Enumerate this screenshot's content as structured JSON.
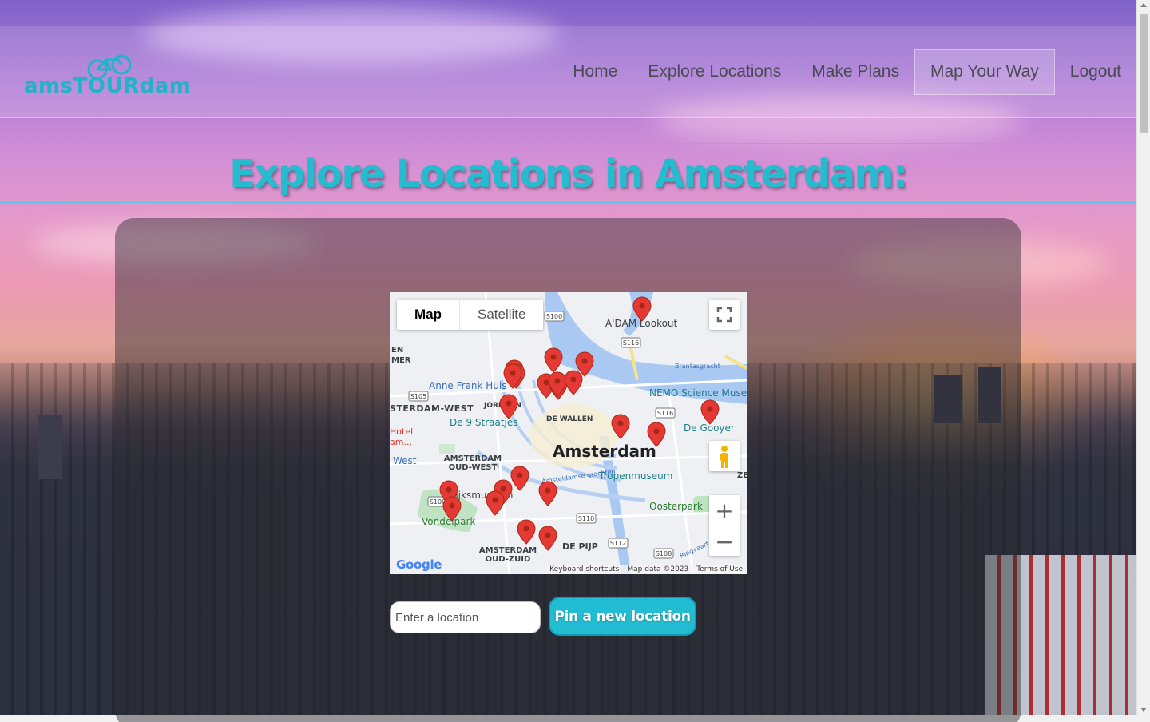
{
  "brand": {
    "logo_text": "amsTOURdam",
    "accent_color": "#1fb4c8"
  },
  "nav": {
    "items": [
      {
        "label": "Home"
      },
      {
        "label": "Explore Locations"
      },
      {
        "label": "Make Plans"
      },
      {
        "label": "Map Your Way",
        "active": true
      },
      {
        "label": "Logout"
      }
    ]
  },
  "page": {
    "title": "Explore Locations in Amsterdam:"
  },
  "map": {
    "type_controls": {
      "map": "Map",
      "satellite": "Satellite",
      "selected": "Map"
    },
    "center_label": "Amsterdam",
    "labels": {
      "adam": "A'DAM Lookout",
      "annefrank": "Anne Frank Huis",
      "nemo": "NEMO Science Muse",
      "westerdam": "STERDAM-WEST",
      "negenstraat": "De 9 Straatjes",
      "dewallen": "DE WALLEN",
      "hotel": "Hotel am...",
      "west": "West",
      "oudwest": "AMSTERDAM OUD-WEST",
      "rijks": "Rijksmuseum",
      "vondel": "Vondelpark",
      "tropen": "Tropenmuseum",
      "oosterpark": "Oosterpark",
      "depijp": "DE PIJP",
      "zuid": "AMSTERDAM OUD-ZUID",
      "dagaat": "De Gooyer",
      "jordaan": "JORDAAN",
      "en": "EN",
      "mer": "MER",
      "ze": "ZE",
      "brantas": "Brantasgracht",
      "amstel": "Amsteldamse grachten",
      "ringvaart": "Ringvaart"
    },
    "road_shields": [
      "S100",
      "S116",
      "S105",
      "S116",
      "S100",
      "S110",
      "S112",
      "S108"
    ],
    "attribution": {
      "shortcuts": "Keyboard shortcuts",
      "data": "Map data ©2023",
      "terms": "Terms of Use"
    },
    "google": "Google",
    "marker_color": "#e53935",
    "marker_count": 22
  },
  "search": {
    "placeholder": "Enter a location",
    "button_label": "Pin a new location"
  }
}
